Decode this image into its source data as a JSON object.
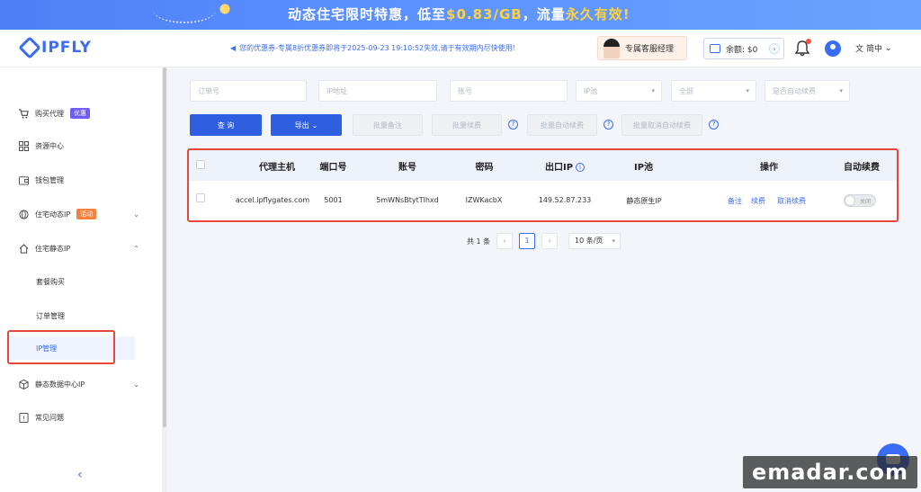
{
  "banner": {
    "text_prefix": "动态住宅限时特惠，低至",
    "price": "$0.83/GB",
    "text_mid": "，流量",
    "highlight": "永久有效!"
  },
  "header": {
    "logo_text": "IPFLY",
    "notice": "您的优惠券-专属8折优惠券即将于2025-09-23 19:10:52失效,请于有效期内尽快使用!",
    "manager_label": "专属客服经理",
    "balance_label": "余额: $0",
    "language": "简中"
  },
  "sidebar": {
    "items": [
      {
        "label": "购买代理",
        "tag": "优惠"
      },
      {
        "label": "资源中心"
      },
      {
        "label": "钱包管理"
      },
      {
        "label": "住宅动态IP",
        "tag": "活动"
      },
      {
        "label": "住宅静态IP"
      },
      {
        "label": "静态数据中心IP"
      },
      {
        "label": "常见问题"
      }
    ],
    "sub_items": [
      {
        "label": "套餐购买"
      },
      {
        "label": "订单管理"
      },
      {
        "label": "IP管理"
      }
    ]
  },
  "filters": {
    "order_no": "订单号",
    "ip_address": "IP地址",
    "account": "账号",
    "ip_pool": "IP池",
    "status": "全部",
    "auto_renew": "是否自动续费"
  },
  "toolbar": {
    "query": "查 询",
    "export": "导出",
    "batch_remark": "批量备注",
    "batch_renew": "批量续费",
    "batch_auto_renew": "批量自动续费",
    "batch_cancel_auto_renew": "批量取消自动续费"
  },
  "table": {
    "headers": [
      "代理主机",
      "端口号",
      "账号",
      "密码",
      "出口IP",
      "IP池",
      "操作",
      "自动续费"
    ],
    "rows": [
      {
        "host": "accel.ipflygates.com",
        "port": "5001",
        "account": "5mWNsBtytTlhxd",
        "password": "IZWKacbX",
        "exit_ip": "149.52.87.233",
        "ip_pool": "静态原生IP",
        "actions": [
          "备注",
          "续费",
          "取消续费"
        ],
        "auto_renew_label": "关闭"
      }
    ]
  },
  "pagination": {
    "total": "共 1 条",
    "current_page": "1",
    "page_size": "10 条/页"
  },
  "watermark": "emadar.com"
}
